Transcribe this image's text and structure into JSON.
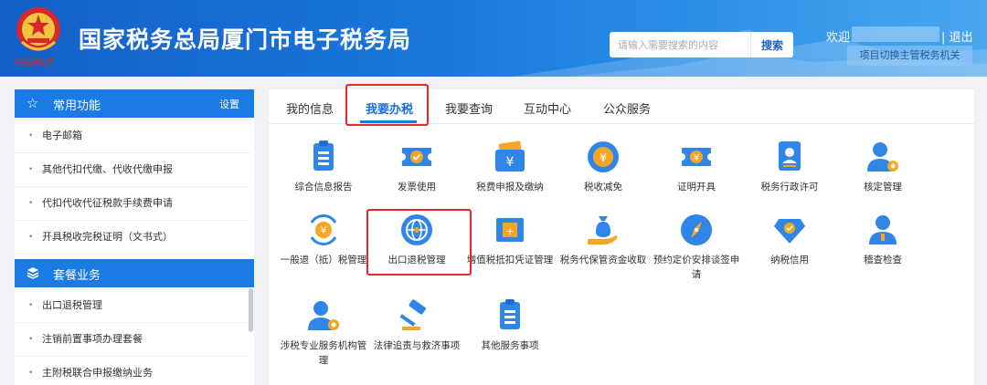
{
  "header": {
    "emblem_text": "中国税务",
    "title": "国家税务总局厦门市电子税务局",
    "search_placeholder": "请输入需要搜索的内容",
    "search_button": "搜索",
    "welcome": "欢迎",
    "logout": "| 退出",
    "switch_org": "项目切换主管税务机关"
  },
  "sidebar": {
    "common": {
      "title": "常用功能",
      "settings": "设置"
    },
    "common_items": [
      "电子邮箱",
      "其他代扣代缴、代收代缴申报",
      "代扣代收代征税款手续费申请",
      "开具税收完税证明（文书式）"
    ],
    "package": {
      "title": "套餐业务"
    },
    "package_items": [
      "出口退税管理",
      "注销前置事项办理套餐",
      "主附税联合申报缴纳业务"
    ]
  },
  "tabs": [
    "我的信息",
    "我要办税",
    "我要查询",
    "互动中心",
    "公众服务"
  ],
  "active_tab": "我要办税",
  "services": [
    {
      "label": "综合信息报告",
      "icon": "document-list-icon"
    },
    {
      "label": "发票使用",
      "icon": "invoice-ticket-icon"
    },
    {
      "label": "税费申报及缴纳",
      "icon": "yuan-wallet-icon"
    },
    {
      "label": "税收减免",
      "icon": "tax-reduction-coin-icon"
    },
    {
      "label": "证明开具",
      "icon": "certificate-icon"
    },
    {
      "label": "税务行政许可",
      "icon": "license-badge-icon"
    },
    {
      "label": "核定管理",
      "icon": "user-gear-icon"
    },
    {
      "label": "一般退（抵）税管理",
      "icon": "refund-yuan-icon"
    },
    {
      "label": "出口退税管理",
      "icon": "globe-export-icon"
    },
    {
      "label": "增值税抵扣凭证管理",
      "icon": "vat-voucher-icon"
    },
    {
      "label": "税务代保管资金收取",
      "icon": "money-bag-hand-icon"
    },
    {
      "label": "预约定价安排谈签申请",
      "icon": "compass-icon"
    },
    {
      "label": "纳税信用",
      "icon": "credit-diamond-icon"
    },
    {
      "label": "稽查检查",
      "icon": "inspector-user-icon"
    },
    {
      "label": "涉税专业服务机构管理",
      "icon": "agency-user-gear-icon"
    },
    {
      "label": "法律追责与救济事项",
      "icon": "gavel-icon"
    },
    {
      "label": "其他服务事项",
      "icon": "clipboard-list-icon"
    }
  ],
  "colors": {
    "brand": "#1a7be4",
    "icon_blue": "#2f86e8",
    "icon_orange": "#f5a623",
    "highlight": "#e8262b"
  }
}
